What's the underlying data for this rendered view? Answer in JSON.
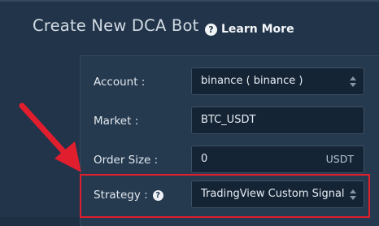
{
  "header": {
    "title": "Create New DCA Bot",
    "learn_more_label": "Learn More",
    "help_icon": "question-circle-icon"
  },
  "form": {
    "account": {
      "label": "Account :",
      "value": "binance ( binance )"
    },
    "market": {
      "label": "Market :",
      "value": "BTC_USDT"
    },
    "order_size": {
      "label": "Order Size :",
      "value": "0",
      "suffix": "USDT"
    },
    "strategy": {
      "label": "Strategy :",
      "help_icon": "question-circle-icon",
      "value": "TradingView Custom Signal"
    }
  },
  "annotation": {
    "arrow_color": "#e01e2e",
    "highlight_color": "#e01e2e"
  }
}
